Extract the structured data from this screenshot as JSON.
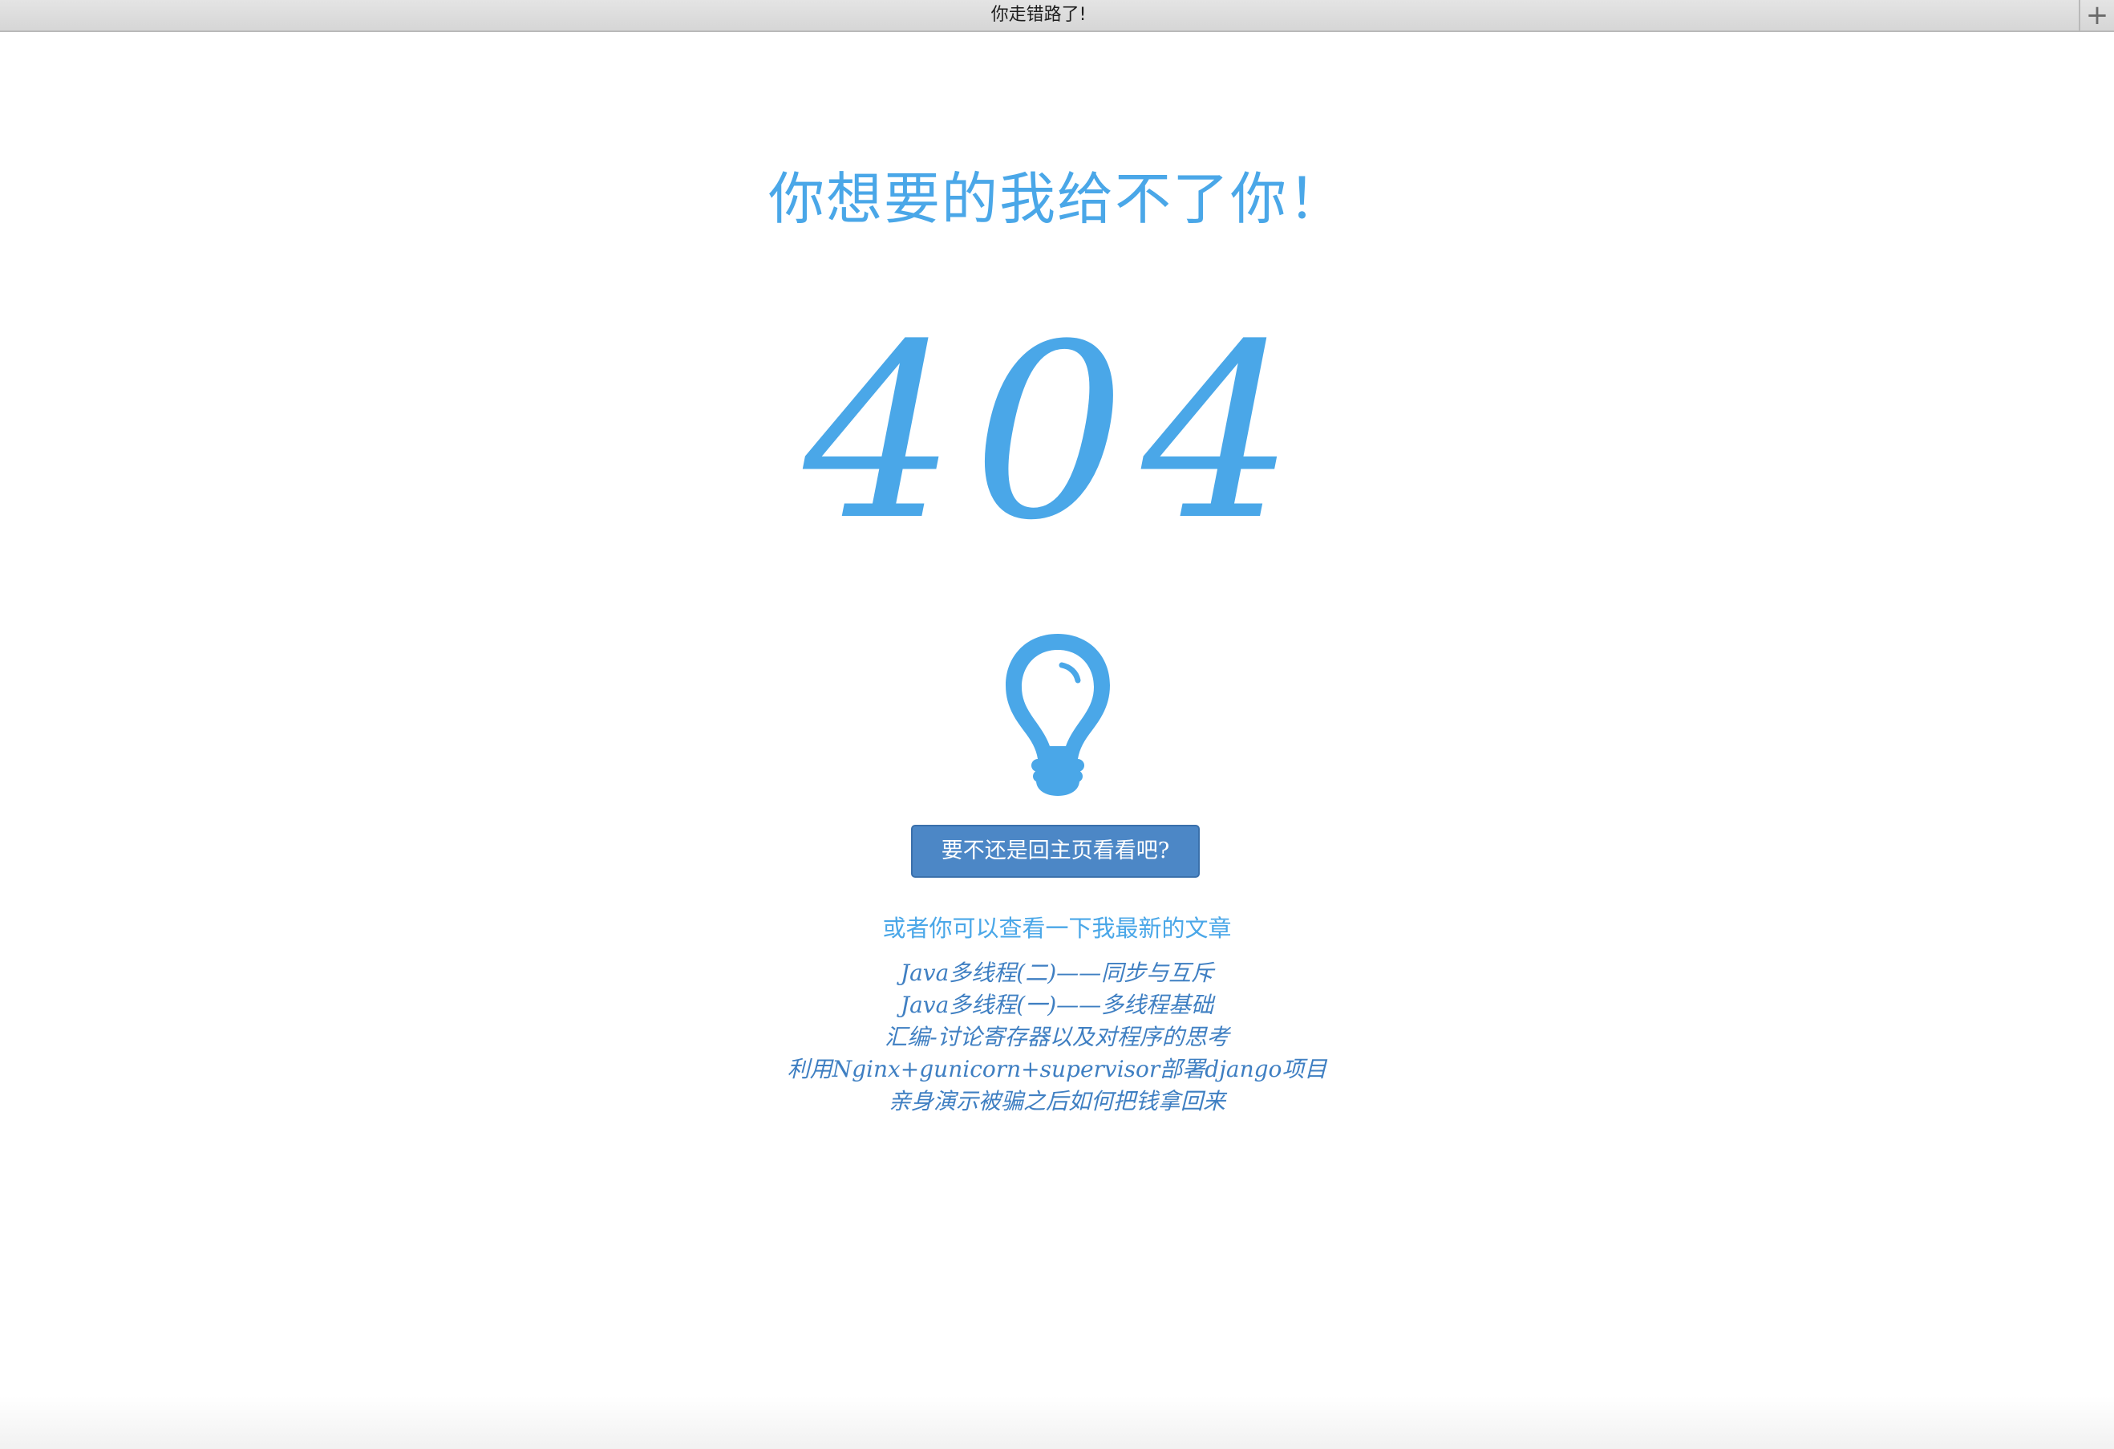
{
  "tab": {
    "title": "你走错路了!",
    "new_tab_symbol": "+"
  },
  "page": {
    "headline": "你想要的我给不了你！",
    "error_code": "404",
    "icon": "lightbulb-icon",
    "home_button_label": "要不还是回主页看看吧?",
    "recent_prompt": "或者你可以查看一下我最新的文章",
    "articles": [
      "Java多线程(二)——同步与互斥",
      "Java多线程(一)——多线程基础",
      "汇编-讨论寄存器以及对程序的思考",
      "利用Nginx+gunicorn+supervisor部署django项目",
      "亲身演示被骗之后如何把钱拿回来"
    ]
  },
  "colors": {
    "accent": "#4aa7e8",
    "button": "#4c87c6",
    "link": "#3f7fc2"
  }
}
